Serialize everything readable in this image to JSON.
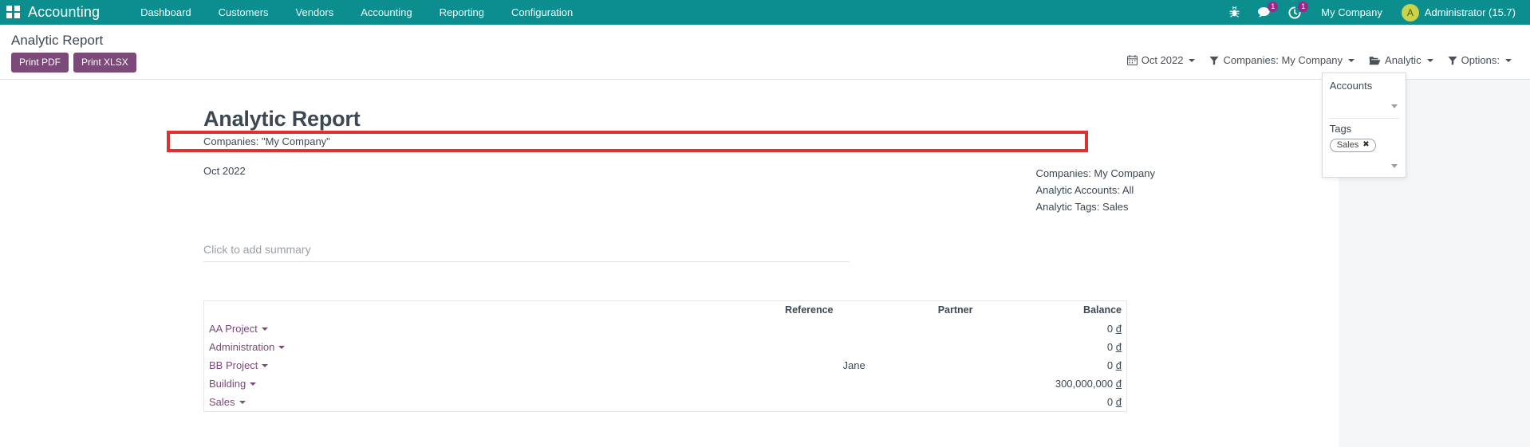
{
  "navbar": {
    "apps_icon": "apps-grid-icon",
    "brand": "Accounting",
    "menu": [
      {
        "label": "Dashboard"
      },
      {
        "label": "Customers"
      },
      {
        "label": "Vendors"
      },
      {
        "label": "Accounting"
      },
      {
        "label": "Reporting"
      },
      {
        "label": "Configuration"
      }
    ],
    "icons": [
      {
        "name": "bug-icon",
        "badge": ""
      },
      {
        "name": "messages-icon",
        "badge": "1"
      },
      {
        "name": "activities-clock-icon",
        "badge": "1"
      }
    ],
    "company": "My Company",
    "user": {
      "initial": "A",
      "name": "Administrator (15.7)"
    },
    "bg_color": "#0C8E8E",
    "badge_color": "#A1248C",
    "avatar_color": "#C9D44B"
  },
  "control_panel": {
    "breadcrumb": "Analytic Report",
    "print_pdf": "Print PDF",
    "print_xlsx": "Print XLSX",
    "filters": [
      {
        "name": "date-filter",
        "icon": "calendar-icon",
        "label": "Oct 2022"
      },
      {
        "name": "companies-filter",
        "icon": "filter-icon",
        "label": "Companies: My Company"
      },
      {
        "name": "analytic-filter",
        "icon": "folder-open-icon",
        "label": "Analytic"
      },
      {
        "name": "options-filter",
        "icon": "filter-icon",
        "label": "Options:"
      }
    ],
    "button_color": "#7C4A78"
  },
  "analytic_dropdown": {
    "open": true,
    "accounts_label": "Accounts",
    "accounts_value": "",
    "tags_label": "Tags",
    "tags": [
      {
        "label": "Sales",
        "remove": "✖"
      }
    ],
    "tags_value": ""
  },
  "report": {
    "title": "Analytic Report",
    "subtitle": "Companies: \"My Company\"",
    "period": "Oct 2022",
    "meta_lines": [
      "Companies: My Company",
      "Analytic Accounts: All",
      "Analytic Tags: Sales"
    ],
    "summary_placeholder": "Click to add summary"
  },
  "table": {
    "columns": [
      "",
      "Reference",
      "Partner",
      "Balance"
    ],
    "rows": [
      {
        "name": "AA Project",
        "reference": "",
        "partner": "",
        "balance": "0",
        "currency": "đ",
        "highlighted": false
      },
      {
        "name": "Administration",
        "reference": "",
        "partner": "",
        "balance": "0",
        "currency": "đ",
        "highlighted": false
      },
      {
        "name": "BB Project",
        "reference": "",
        "partner": "Jane",
        "balance": "0",
        "currency": "đ",
        "highlighted": false
      },
      {
        "name": "Building",
        "reference": "",
        "partner": "",
        "balance": "300,000,000",
        "currency": "đ",
        "highlighted": true
      },
      {
        "name": "Sales",
        "reference": "",
        "partner": "",
        "balance": "0",
        "currency": "đ",
        "highlighted": false
      }
    ],
    "highlight_color": "#E03131"
  }
}
